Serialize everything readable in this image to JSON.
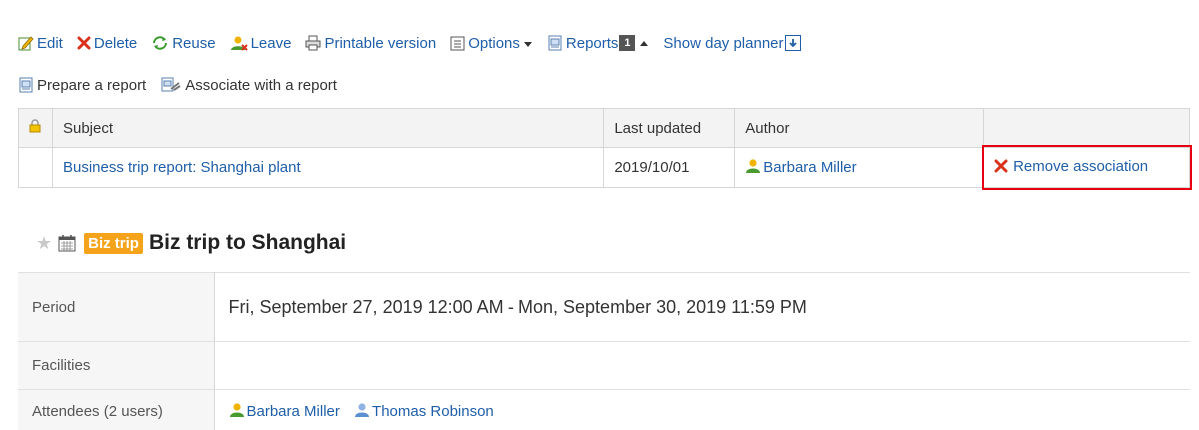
{
  "toolbar": {
    "edit": "Edit",
    "delete": "Delete",
    "reuse": "Reuse",
    "leave": "Leave",
    "printable": "Printable version",
    "options": "Options",
    "reports": "Reports",
    "reports_count": "1",
    "day_planner": "Show day planner"
  },
  "actions": {
    "prepare_report": "Prepare a report",
    "associate_report": "Associate with a report"
  },
  "reports_table": {
    "headers": {
      "subject": "Subject",
      "last_updated": "Last updated",
      "author": "Author"
    },
    "rows": [
      {
        "subject": "Business trip report: Shanghai plant",
        "last_updated": "2019/10/01",
        "author": "Barbara Miller",
        "action": "Remove association"
      }
    ]
  },
  "event": {
    "badge": "Biz trip",
    "title": "Biz trip to Shanghai"
  },
  "details": {
    "period_label": "Period",
    "period_start": "Fri, September 27, 2019 12:00 AM",
    "period_sep": "-",
    "period_end": "Mon, September 30, 2019 11:59 PM",
    "facilities_label": "Facilities",
    "attendees_label": "Attendees (2 users)",
    "attendees": [
      "Barbara Miller",
      "Thomas Robinson"
    ]
  },
  "colors": {
    "link": "#1f5ea8",
    "highlight": "#e60012",
    "badge": "#f5a31a"
  }
}
